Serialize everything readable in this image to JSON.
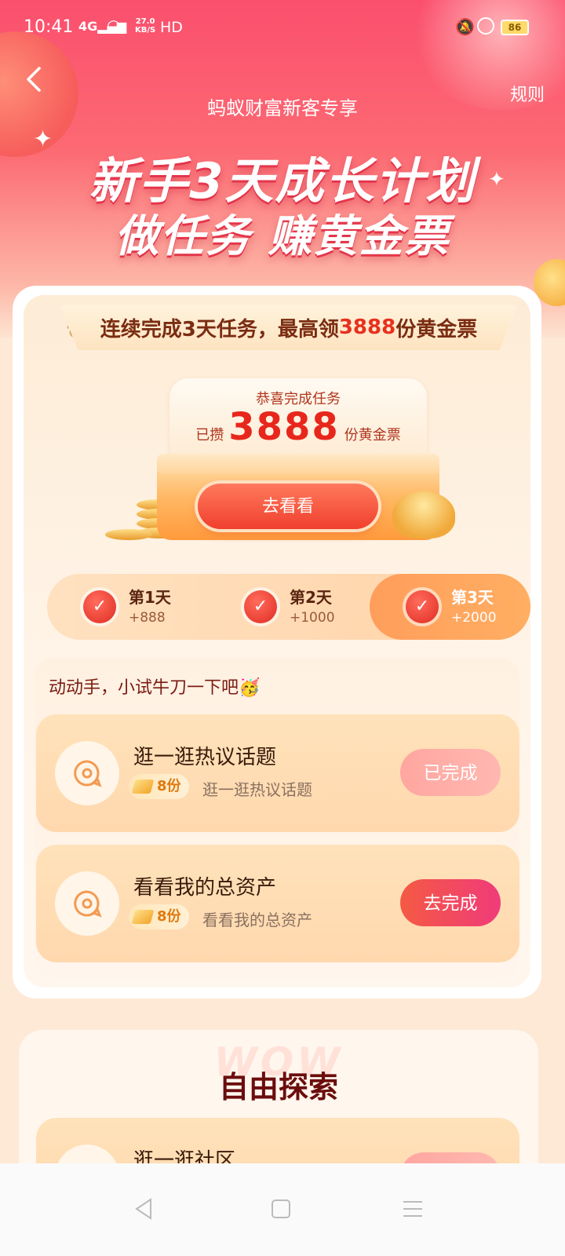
{
  "status_bar": {
    "time": "10:41",
    "signal": "4G",
    "speed_value": "27.0",
    "speed_unit": "KB/S",
    "hd": "HD",
    "battery": "86"
  },
  "header": {
    "rules_label": "规则",
    "subtitle": "蚂蚁财富新客专享",
    "title_line1": "新手3天成长计划",
    "title_line2": "做任务 赚黄金票"
  },
  "banner": {
    "prefix": "连续完成3天任务，最高领",
    "highlight": "3888",
    "suffix": "份黄金票"
  },
  "reward_box": {
    "congrats": "恭喜完成任务",
    "saved_prefix": "已攒",
    "amount": "3888",
    "saved_suffix": "份黄金票",
    "button_label": "去看看"
  },
  "days": [
    {
      "label": "第1天",
      "points": "+888",
      "active": false
    },
    {
      "label": "第2天",
      "points": "+1000",
      "active": false
    },
    {
      "label": "第3天",
      "points": "+2000",
      "active": true
    }
  ],
  "tasks_section": {
    "heading": "动动手，小试牛刀一下吧🥳",
    "items": [
      {
        "name": "逛一逛热议话题",
        "reward": "8份",
        "desc": "逛一逛热议话题",
        "button": "已完成",
        "status": "done"
      },
      {
        "name": "看看我的总资产",
        "reward": "8份",
        "desc": "看看我的总资产",
        "button": "去完成",
        "status": "todo"
      }
    ]
  },
  "explore": {
    "watermark": "WOW",
    "title": "自由探索",
    "first_item": "逛一逛社区"
  },
  "icons": {
    "back": "chevron-left-icon",
    "task": "chat-bubble-icon",
    "check": "check-icon",
    "nav_back": "triangle-back-icon",
    "nav_home": "square-home-icon",
    "nav_menu": "menu-lines-icon"
  },
  "colors": {
    "hero_top": "#fb4f6e",
    "accent_red": "#e8271c",
    "active_day": "#ff9e5c",
    "todo_button": "#f45a43"
  }
}
